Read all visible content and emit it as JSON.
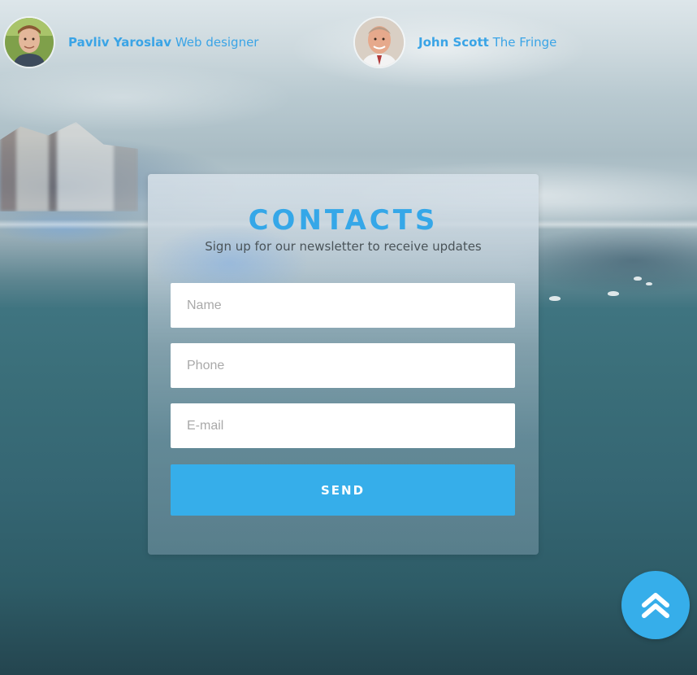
{
  "testimonials": [
    {
      "name": "Pavliv Yaroslav",
      "role": "Web designer"
    },
    {
      "name": "John Scott",
      "role": "The Fringe"
    }
  ],
  "contacts": {
    "title": "CONTACTS",
    "subtitle": "Sign up for our newsletter to receive updates",
    "name_placeholder": "Name",
    "phone_placeholder": "Phone",
    "email_placeholder": "E-mail",
    "send_label": "SEND"
  },
  "colors": {
    "accent": "#36aeea",
    "link": "#3aa4e6"
  },
  "icons": {
    "scroll_top": "double-chevron-up-icon"
  }
}
